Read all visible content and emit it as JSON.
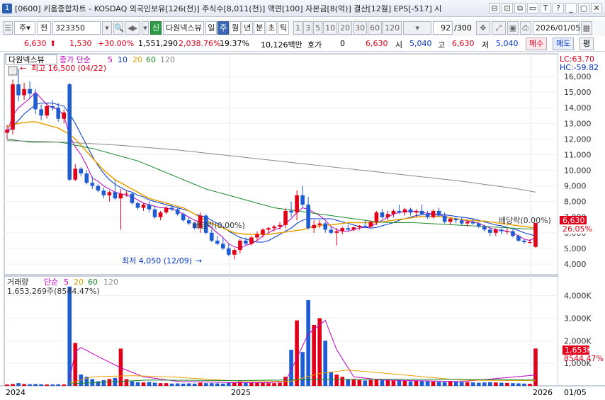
{
  "window": {
    "number": "1",
    "title": "[0600] 키움종합차트 - KOSDAQ 외국인보유[126(천)] 주식수[8,011(천)] 액면[100] 자본금[8(억)] 결산[12월] EPS[-517] 시",
    "controls": [
      "⊟",
      "⊡",
      "⧉",
      "▭",
      "T",
      "?",
      "_",
      "▢",
      "✕"
    ]
  },
  "toolbar": {
    "type_label": "주",
    "jeon_label": "전",
    "code": "323350",
    "sound_icon": "speaker-icon",
    "new_badge": "신",
    "stock_name": "다원넥스뷰",
    "periods": [
      "일",
      "주",
      "월",
      "년",
      "분",
      "초",
      "틱"
    ],
    "selected_period": "주",
    "numbers": [
      "1",
      "3",
      "5",
      "10",
      "20",
      "30",
      "60",
      "120"
    ],
    "count": "92",
    "count_total": "/300",
    "date": "2026/01/05"
  },
  "quote": {
    "price": "6,630",
    "arrow": "⬆",
    "change": "1,530",
    "change_pct": "+30.00%",
    "volume": "1,551,290",
    "vol_ratio": "2,038.76%",
    "turnover": "19.37%",
    "amount": "10,126백만",
    "hoga_label": "호가",
    "hoga_value": "0",
    "hoga_price": "6,630",
    "open_label": "시",
    "open": "5,040",
    "high_label": "고",
    "high": "6,630",
    "low_label": "저",
    "low": "5,040",
    "buy_label": "매수",
    "sell_label": "매도",
    "eval_label": "평"
  },
  "price_chart": {
    "stock_label": "다원넥스뷰",
    "ma_label": "종가 단순",
    "ma_periods": [
      "5",
      "10",
      "20",
      "60",
      "120"
    ],
    "ma_colors": [
      "#c000c0",
      "#0033cc",
      "#e8a000",
      "#1a8a2a",
      "#888888"
    ],
    "high_note": "최고 16,500 (04/22)",
    "low_note": "최저 4,050 (12/09)",
    "div_note_1": "배당락(0.00%)",
    "div_note_2": "배당락(0.00%)",
    "lc": "LC:63.70",
    "hc": "HC:-59.82",
    "price_tag": "6,630",
    "pct_tag": "26.05%",
    "y_ticks": [
      "16,000",
      "15,000",
      "14,000",
      "13,000",
      "12,000",
      "11,000",
      "10,000",
      "9,000",
      "8,000",
      "7,000",
      "6,000",
      "5,000",
      "4,000"
    ]
  },
  "volume_chart": {
    "label": "거래량",
    "ma_label": "단순",
    "ma_periods": [
      "5",
      "20",
      "60",
      "120"
    ],
    "value_line": "1,653,269주(8544.47%)",
    "y_ticks": [
      "4,000K",
      "3,000K",
      "2,000K",
      "1,000K"
    ],
    "tag_value": "1,653K",
    "tag_pct": "8544.47%"
  },
  "x_axis": {
    "labels": [
      "2024",
      "2025",
      "2026"
    ],
    "right_label": "01/05"
  },
  "chart_data": {
    "type": "candlestick",
    "period": "weekly",
    "y_range": [
      3500,
      17000
    ],
    "candles": [
      [
        12400,
        12900,
        12000,
        12600
      ],
      [
        12600,
        15800,
        12300,
        15500
      ],
      [
        15500,
        16500,
        14400,
        14800
      ],
      [
        14800,
        15600,
        14500,
        15200
      ],
      [
        15200,
        15700,
        14600,
        14900
      ],
      [
        14900,
        15200,
        13600,
        13900
      ],
      [
        13900,
        14200,
        13200,
        13500
      ],
      [
        13500,
        14300,
        13300,
        14100
      ],
      [
        14100,
        14500,
        13800,
        14000
      ],
      [
        14000,
        14300,
        13100,
        13300
      ],
      [
        13300,
        13900,
        13000,
        13700
      ],
      [
        15500,
        15600,
        9300,
        9400
      ],
      [
        9400,
        10400,
        9300,
        10100
      ],
      [
        10100,
        10200,
        9600,
        9800
      ],
      [
        9800,
        10000,
        9100,
        9200
      ],
      [
        9200,
        9600,
        8800,
        9000
      ],
      [
        9000,
        9100,
        8600,
        8700
      ],
      [
        8700,
        8900,
        8200,
        8400
      ],
      [
        8400,
        8700,
        8000,
        8600
      ],
      [
        8600,
        9400,
        8100,
        8200
      ],
      [
        8200,
        8800,
        6200,
        8500
      ],
      [
        8500,
        8700,
        8300,
        8500
      ],
      [
        8500,
        8600,
        7800,
        7900
      ],
      [
        7900,
        8000,
        7500,
        7600
      ],
      [
        7600,
        7900,
        7400,
        7800
      ],
      [
        7800,
        8000,
        7300,
        7500
      ],
      [
        7500,
        7700,
        6900,
        7000
      ],
      [
        7000,
        7400,
        6800,
        7300
      ],
      [
        7300,
        7700,
        7200,
        7600
      ],
      [
        7600,
        7800,
        7400,
        7500
      ],
      [
        7500,
        7600,
        7100,
        7200
      ],
      [
        7200,
        7300,
        6700,
        6800
      ],
      [
        6800,
        7000,
        6500,
        6600
      ],
      [
        6600,
        6700,
        6200,
        6300
      ],
      [
        6300,
        7300,
        6000,
        7100
      ],
      [
        7100,
        7200,
        5900,
        6000
      ],
      [
        6000,
        6200,
        5400,
        5500
      ],
      [
        5500,
        5800,
        5200,
        5300
      ],
      [
        5300,
        5700,
        4900,
        5000
      ],
      [
        5000,
        5300,
        4500,
        4600
      ],
      [
        4600,
        5000,
        4300,
        4900
      ],
      [
        4900,
        5600,
        4700,
        5500
      ],
      [
        5500,
        5700,
        5200,
        5300
      ],
      [
        5300,
        5800,
        5200,
        5700
      ],
      [
        5700,
        6100,
        5500,
        5900
      ],
      [
        5900,
        6300,
        5700,
        6200
      ],
      [
        6200,
        6400,
        6000,
        6300
      ],
      [
        6300,
        6500,
        6100,
        6400
      ],
      [
        6400,
        6700,
        6200,
        6500
      ],
      [
        6500,
        7600,
        6300,
        7400
      ],
      [
        7400,
        8000,
        7000,
        7300
      ],
      [
        7300,
        8700,
        6800,
        8400
      ],
      [
        8400,
        9000,
        7600,
        7800
      ],
      [
        7800,
        8300,
        6200,
        6300
      ],
      [
        6300,
        6800,
        6000,
        6500
      ],
      [
        6500,
        6800,
        6300,
        6600
      ],
      [
        6600,
        6700,
        6000,
        6200
      ],
      [
        6200,
        6400,
        5900,
        6000
      ],
      [
        6000,
        6300,
        5200,
        6100
      ],
      [
        6100,
        6400,
        5900,
        6300
      ],
      [
        6300,
        6500,
        6100,
        6200
      ],
      [
        6200,
        6400,
        6100,
        6350
      ],
      [
        6350,
        6500,
        6200,
        6450
      ],
      [
        6450,
        6800,
        6300,
        6400
      ],
      [
        6400,
        6800,
        6300,
        6700
      ],
      [
        6700,
        7400,
        6500,
        7300
      ],
      [
        7300,
        7500,
        6900,
        7000
      ],
      [
        7000,
        7400,
        6800,
        7200
      ],
      [
        7200,
        7500,
        7000,
        7400
      ],
      [
        7400,
        7800,
        7200,
        7300
      ],
      [
        7300,
        7600,
        7100,
        7500
      ],
      [
        7500,
        7600,
        7100,
        7300
      ],
      [
        7300,
        7500,
        7000,
        7400
      ],
      [
        7400,
        7800,
        7200,
        7200
      ],
      [
        7200,
        7400,
        6900,
        7000
      ],
      [
        7000,
        7500,
        6900,
        7400
      ],
      [
        7400,
        7600,
        7000,
        7100
      ],
      [
        7100,
        7300,
        6600,
        6700
      ],
      [
        6700,
        7000,
        6500,
        6900
      ],
      [
        6900,
        7000,
        6600,
        6800
      ],
      [
        6800,
        7000,
        6500,
        6600
      ],
      [
        6600,
        6800,
        6400,
        6700
      ],
      [
        6700,
        6900,
        6500,
        6600
      ],
      [
        6600,
        6700,
        6300,
        6400
      ],
      [
        6400,
        6500,
        6100,
        6200
      ],
      [
        6200,
        6400,
        5800,
        6000
      ],
      [
        6000,
        6300,
        5800,
        6200
      ],
      [
        6200,
        6300,
        5900,
        6100
      ],
      [
        6100,
        6300,
        5900,
        6100
      ],
      [
        6100,
        6200,
        5700,
        5800
      ],
      [
        5800,
        5900,
        5400,
        5500
      ],
      [
        5500,
        5600,
        5300,
        5400
      ],
      [
        5400,
        5600,
        5300,
        5400
      ],
      [
        5100,
        6630,
        5040,
        6630
      ]
    ],
    "ma5": [
      12400,
      13500,
      14000,
      14300,
      14600,
      15000,
      14600,
      14200,
      14000,
      13900,
      13500,
      12200,
      11500,
      11000,
      10300,
      9500,
      9300,
      9000,
      8800,
      8600,
      8500,
      8400,
      8300,
      8100,
      7900,
      7800,
      7700,
      7600,
      7600,
      7500,
      7400,
      7200,
      7000,
      6800,
      6700,
      6600,
      6300,
      6000,
      5700,
      5300,
      5100,
      5000,
      5200,
      5300,
      5500,
      5800,
      6000,
      6200,
      6300,
      6600,
      6900,
      7300,
      7600,
      7500,
      7300,
      7100,
      6800,
      6400,
      6200,
      6100,
      6100,
      6200,
      6300,
      6350,
      6400,
      6600,
      6800,
      7000,
      7200,
      7300,
      7350,
      7400,
      7350,
      7300,
      7250,
      7200,
      7150,
      7050,
      6950,
      6900,
      6850,
      6750,
      6700,
      6600,
      6450,
      6300,
      6200,
      6150,
      6100,
      6000,
      5800,
      5600,
      5500,
      5700
    ],
    "ma10": [
      12400,
      12800,
      13200,
      13600,
      13900,
      14200,
      14300,
      14300,
      14300,
      14200,
      14100,
      13600,
      13000,
      12300,
      11600,
      10900,
      10300,
      9800,
      9400,
      9100,
      8900,
      8700,
      8600,
      8400,
      8300,
      8100,
      8000,
      7900,
      7800,
      7700,
      7600,
      7500,
      7400,
      7200,
      7100,
      7000,
      6800,
      6600,
      6400,
      6100,
      5900,
      5700,
      5600,
      5500,
      5400,
      5400,
      5500,
      5700,
      5900,
      6100,
      6300,
      6600,
      6800,
      6900,
      6900,
      6900,
      6900,
      6900,
      6800,
      6700,
      6600,
      6500,
      6400,
      6350,
      6300,
      6350,
      6450,
      6550,
      6650,
      6800,
      6900,
      7000,
      7100,
      7150,
      7200,
      7200,
      7200,
      7150,
      7100,
      7050,
      7000,
      6950,
      6900,
      6800,
      6700,
      6600,
      6500,
      6450,
      6350,
      6250,
      6150,
      6000,
      5900,
      5800
    ],
    "ma20": [
      12800,
      12900,
      13000,
      13050,
      13100,
      13100,
      13000,
      12900,
      12800,
      12700,
      12500,
      12300,
      12000,
      11600,
      11200,
      10800,
      10400,
      10000,
      9700,
      9400,
      9200,
      9000,
      8800,
      8600,
      8400,
      8200,
      8100,
      8000,
      7900,
      7800,
      7700,
      7600,
      7400,
      7200,
      7000,
      6800,
      6600,
      6450,
      6300,
      6150,
      6000,
      5950,
      5900,
      5900,
      5900,
      5900,
      5900,
      5950,
      6000,
      6050,
      6100,
      6150,
      6200,
      6300,
      6400,
      6450,
      6500,
      6500,
      6550,
      6600,
      6650,
      6650,
      6650,
      6650,
      6650,
      6650,
      6700,
      6750,
      6800,
      6850,
      6900,
      6950,
      7000,
      7050,
      7050,
      7050,
      7050,
      7000,
      6950,
      6900,
      6850,
      6800,
      6800,
      6750,
      6750,
      6700,
      6650,
      6600,
      6550,
      6500,
      6450,
      6400,
      6350,
      6300
    ],
    "ma60": [
      12000,
      11950,
      11900,
      11850,
      11800,
      11800,
      11800,
      11800,
      11800,
      11800,
      11750,
      11700,
      11600,
      11550,
      11450,
      11400,
      11300,
      11200,
      11100,
      11000,
      10900,
      10800,
      10700,
      10600,
      10450,
      10300,
      10150,
      10000,
      9850,
      9700,
      9550,
      9400,
      9250,
      9100,
      8950,
      8800,
      8700,
      8600,
      8500,
      8400,
      8300,
      8200,
      8100,
      8000,
      7900,
      7800,
      7700,
      7600,
      7550,
      7500,
      7450,
      7400,
      7350,
      7300,
      7250,
      7200,
      7150,
      7100,
      7050,
      7000,
      6950,
      6900,
      6850,
      6800,
      6750,
      6700,
      6680,
      6660,
      6650,
      6650,
      6650,
      6650,
      6640,
      6620,
      6600,
      6580,
      6560,
      6540,
      6520,
      6500,
      6480,
      6460,
      6440,
      6420,
      6400,
      6380,
      6360,
      6340,
      6320,
      6300,
      6280,
      6260,
      6240,
      6230
    ],
    "ma120": [
      null,
      null,
      null,
      null,
      null,
      null,
      null,
      null,
      null,
      null,
      null,
      null,
      null,
      null,
      null,
      null,
      null,
      null,
      null,
      null,
      null,
      null,
      null,
      null,
      null,
      null,
      null,
      null,
      null,
      null,
      null,
      null,
      null,
      null,
      null,
      null,
      null,
      null,
      null,
      null,
      null,
      null,
      null,
      null,
      null,
      null,
      null,
      null,
      null,
      null,
      null,
      null,
      null,
      null,
      null,
      null,
      null,
      null,
      null,
      null,
      null,
      null,
      null,
      null,
      null,
      null,
      null,
      null,
      null,
      null,
      null,
      null,
      null,
      null,
      null,
      null,
      null,
      null,
      null,
      null,
      null,
      null,
      null,
      null,
      null,
      null,
      null,
      null,
      null,
      null,
      null,
      null,
      null,
      null
    ],
    "ma120_line": [
      [
        0,
        11900
      ],
      [
        10,
        11800
      ],
      [
        20,
        11600
      ],
      [
        30,
        11300
      ],
      [
        40,
        10900
      ],
      [
        50,
        10500
      ],
      [
        60,
        10100
      ],
      [
        70,
        9700
      ],
      [
        80,
        9300
      ],
      [
        90,
        8800
      ],
      [
        93,
        8600
      ]
    ],
    "volume_k": [
      60,
      80,
      120,
      80,
      70,
      80,
      70,
      60,
      60,
      70,
      60,
      4400,
      1900,
      500,
      400,
      300,
      200,
      250,
      300,
      350,
      1650,
      300,
      200,
      160,
      150,
      170,
      140,
      120,
      120,
      100,
      110,
      100,
      110,
      100,
      140,
      120,
      120,
      110,
      100,
      130,
      150,
      180,
      160,
      150,
      140,
      130,
      120,
      120,
      140,
      400,
      1600,
      2900,
      1500,
      3800,
      2700,
      3000,
      2000,
      600,
      500,
      400,
      300,
      280,
      260,
      240,
      260,
      300,
      250,
      260,
      230,
      240,
      220,
      200,
      230,
      210,
      200,
      190,
      180,
      170,
      200,
      180,
      170,
      160,
      150,
      140,
      150,
      160,
      150,
      140,
      130,
      120,
      110,
      100,
      90,
      1653
    ],
    "volume_ma5_line": [
      [
        11,
        300
      ],
      [
        12,
        1500
      ],
      [
        13,
        1700
      ],
      [
        16,
        1300
      ],
      [
        20,
        800
      ],
      [
        24,
        400
      ],
      [
        30,
        200
      ],
      [
        40,
        140
      ],
      [
        46,
        140
      ],
      [
        49,
        200
      ],
      [
        50,
        700
      ],
      [
        53,
        2300
      ],
      [
        56,
        2900
      ],
      [
        58,
        1600
      ],
      [
        61,
        400
      ],
      [
        66,
        260
      ],
      [
        80,
        190
      ],
      [
        93,
        480
      ]
    ],
    "volume_ma20_line": [
      [
        11,
        120
      ],
      [
        15,
        400
      ],
      [
        22,
        450
      ],
      [
        30,
        380
      ],
      [
        40,
        220
      ],
      [
        50,
        200
      ],
      [
        55,
        550
      ],
      [
        60,
        700
      ],
      [
        70,
        480
      ],
      [
        80,
        250
      ],
      [
        93,
        230
      ]
    ],
    "volume_ma60_line": [
      [
        11,
        90
      ],
      [
        25,
        260
      ],
      [
        40,
        230
      ],
      [
        55,
        280
      ],
      [
        70,
        300
      ],
      [
        93,
        260
      ]
    ],
    "vol_y_range": [
      0,
      4800
    ]
  }
}
